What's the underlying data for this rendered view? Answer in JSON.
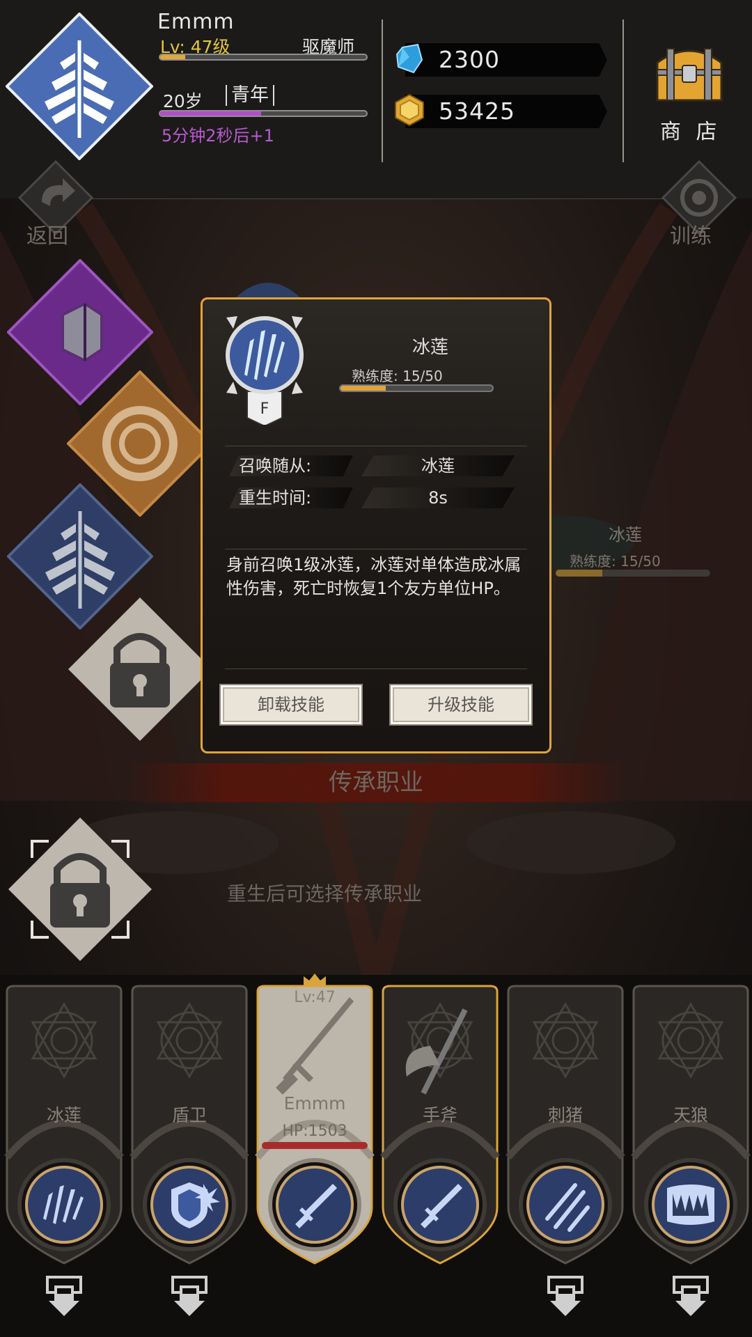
{
  "player": {
    "name": "Emmm",
    "level": "Lv: 47级",
    "job": "驱魔师",
    "level_progress": 0.12,
    "age": "20岁",
    "stage": "青年",
    "age_progress": 0.49,
    "timer": "5分钟2秒后+1"
  },
  "currency": {
    "gems": "2300",
    "gold": "53425"
  },
  "shop": {
    "label": "商 店"
  },
  "nav": {
    "back": "返回",
    "train": "训练"
  },
  "inherit": {
    "title": "传承职业",
    "hint": "重生后可选择传承职业"
  },
  "behind_skill": {
    "name": "冰莲",
    "proficiency": "熟练度: 15/50"
  },
  "popup": {
    "skill_name": "冰莲",
    "grade": "F",
    "proficiency": "熟练度: 15/50",
    "proficiency_value": 15,
    "proficiency_max": 50,
    "rows": [
      {
        "label": "召唤随从:",
        "value": "冰莲"
      },
      {
        "label": "重生时间:",
        "value": "8s"
      }
    ],
    "description": "身前召唤1级冰莲，冰莲对单体造成冰属性伤害，死亡时恢复1个友方单位HP。",
    "unload_button": "卸载技能",
    "upgrade_button": "升级技能"
  },
  "team": {
    "cards": [
      {
        "name": "冰莲",
        "icon": "ice-shards-icon",
        "arrow": true
      },
      {
        "name": "盾卫",
        "icon": "shield-icon",
        "arrow": true
      },
      {
        "name": "Emmm",
        "icon": "sword-icon",
        "selected": true,
        "lv": "Lv:47",
        "hp": "HP:1503"
      },
      {
        "name": "手斧",
        "icon": "sword-icon",
        "arrow": false
      },
      {
        "name": "刺猪",
        "icon": "claw-icon",
        "arrow": true
      },
      {
        "name": "天狼",
        "icon": "fangs-icon",
        "arrow": true
      }
    ]
  },
  "colors": {
    "accent_gold": "#e0a53a",
    "level_yellow": "#e3c53a",
    "timer_purple": "#b95bd0",
    "hp_red": "#a82b2b"
  }
}
